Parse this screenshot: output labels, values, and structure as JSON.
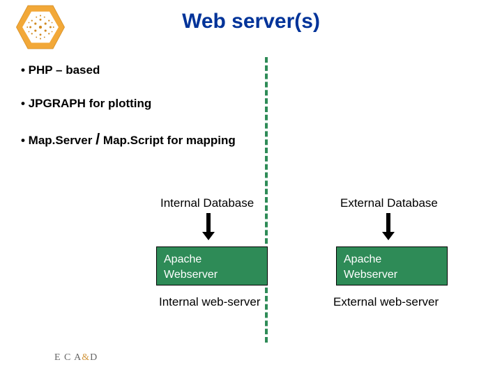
{
  "title": "Web server(s)",
  "bullets": {
    "b1": "• PHP – based",
    "b2_pre": "• JPGRAPH  for plotting",
    "b3_pre": "• Map.Server ",
    "b3_slash": "/",
    "b3_post": " Map.Script for mapping"
  },
  "labels": {
    "internal_db": "Internal Database",
    "external_db": "External Database"
  },
  "boxes": {
    "left_line1": "Apache",
    "left_line2": "Webserver",
    "right_line1": "Apache",
    "right_line2": "Webserver"
  },
  "captions": {
    "left": "Internal web-server",
    "right": "External web-server"
  },
  "footer": {
    "part1": "E C A",
    "amp": "&",
    "part2": "D"
  }
}
